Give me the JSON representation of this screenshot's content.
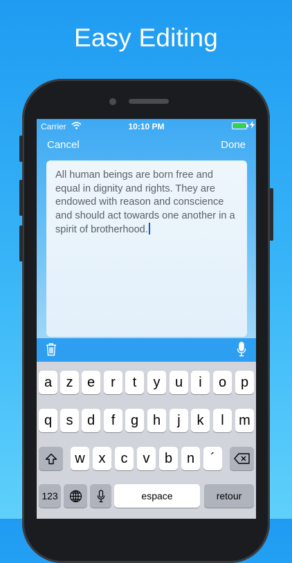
{
  "headline": "Easy Editing",
  "status_bar": {
    "carrier": "Carrier",
    "time": "10:10 PM",
    "battery_level": 1.0
  },
  "nav": {
    "cancel_label": "Cancel",
    "done_label": "Done"
  },
  "note": {
    "text": "All human beings are born free and equal in dignity and rights. They are endowed with reason and conscience and should act towards one another in a spirit of brotherhood."
  },
  "toolbar": {
    "left_icon": "trash-icon",
    "right_icon": "microphone-icon"
  },
  "keyboard": {
    "row1": [
      "a",
      "z",
      "e",
      "r",
      "t",
      "y",
      "u",
      "i",
      "o",
      "p"
    ],
    "row2": [
      "q",
      "s",
      "d",
      "f",
      "g",
      "h",
      "j",
      "k",
      "l",
      "m"
    ],
    "row3": [
      "w",
      "x",
      "c",
      "v",
      "b",
      "n",
      "´"
    ],
    "numbers_label": "123",
    "space_label": "espace",
    "return_label": "retour"
  },
  "colors": {
    "accent": "#2e9ff0",
    "battery": "#35d34a",
    "caret": "#1558d6"
  }
}
